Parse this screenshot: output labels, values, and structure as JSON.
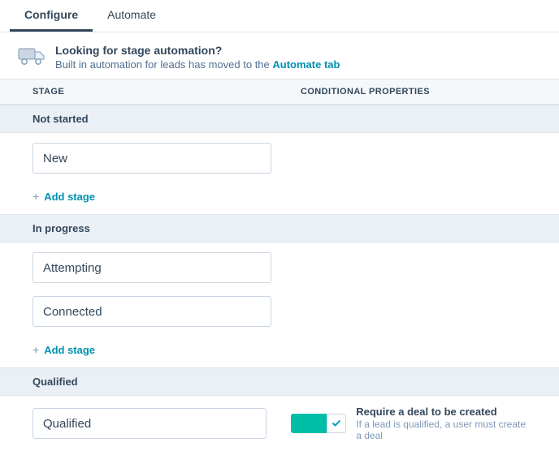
{
  "tabs": {
    "configure": "Configure",
    "automate": "Automate"
  },
  "banner": {
    "title": "Looking for stage automation?",
    "sub_prefix": "Built in automation for leads has moved to the ",
    "link": "Automate tab"
  },
  "headers": {
    "stage": "STAGE",
    "conditional": "CONDITIONAL PROPERTIES"
  },
  "groups": {
    "not_started": {
      "label": "Not started",
      "stages": {
        "s0": "New"
      }
    },
    "in_progress": {
      "label": "In progress",
      "stages": {
        "s0": "Attempting",
        "s1": "Connected"
      }
    },
    "qualified": {
      "label": "Qualified",
      "stages": {
        "s0": "Qualified"
      }
    }
  },
  "add_stage_label": "Add stage",
  "conditional": {
    "require_deal_title": "Require a deal to be created",
    "require_deal_sub": "If a lead is qualified, a user must create a deal"
  }
}
